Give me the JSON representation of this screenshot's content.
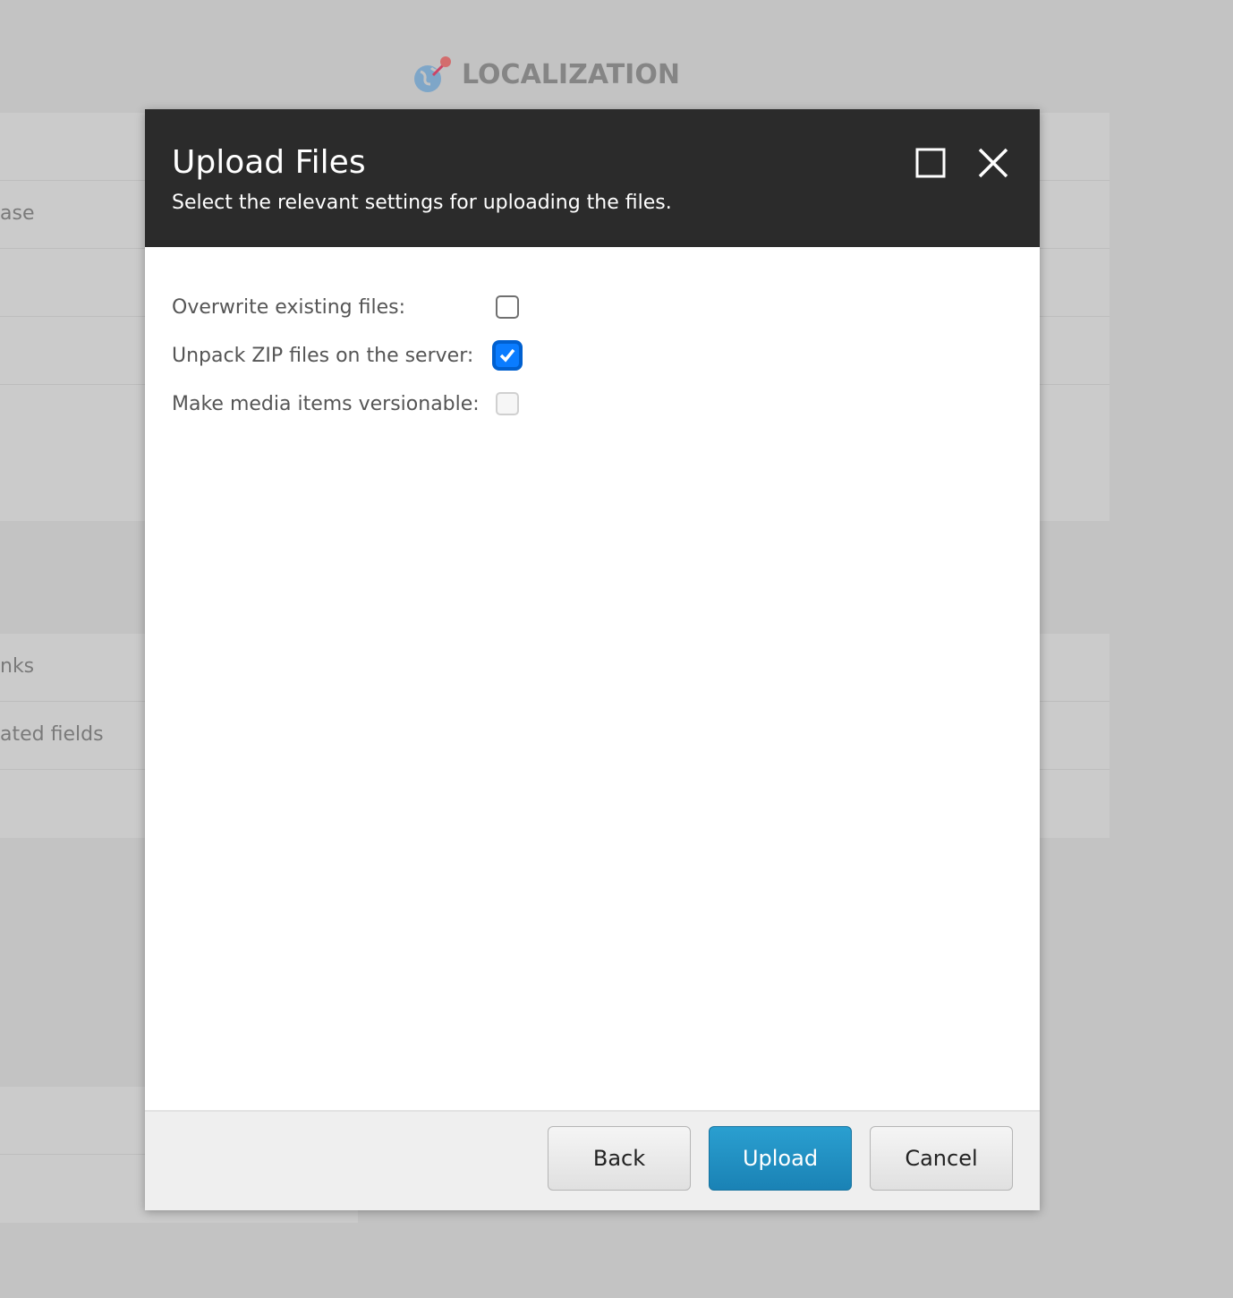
{
  "background": {
    "title": "LOCALIZATION",
    "rows": [
      "ase",
      "nks",
      "ated fields"
    ]
  },
  "dialog": {
    "title": "Upload Files",
    "subtitle": "Select the relevant settings for uploading the files.",
    "options": [
      {
        "label": "Overwrite existing files:",
        "checked": false,
        "disabled": false
      },
      {
        "label": "Unpack ZIP files on the server:",
        "checked": true,
        "disabled": false
      },
      {
        "label": "Make media items versionable:",
        "checked": false,
        "disabled": true
      }
    ],
    "buttons": {
      "back": "Back",
      "upload": "Upload",
      "cancel": "Cancel"
    },
    "accent": "#1a8fc4"
  }
}
